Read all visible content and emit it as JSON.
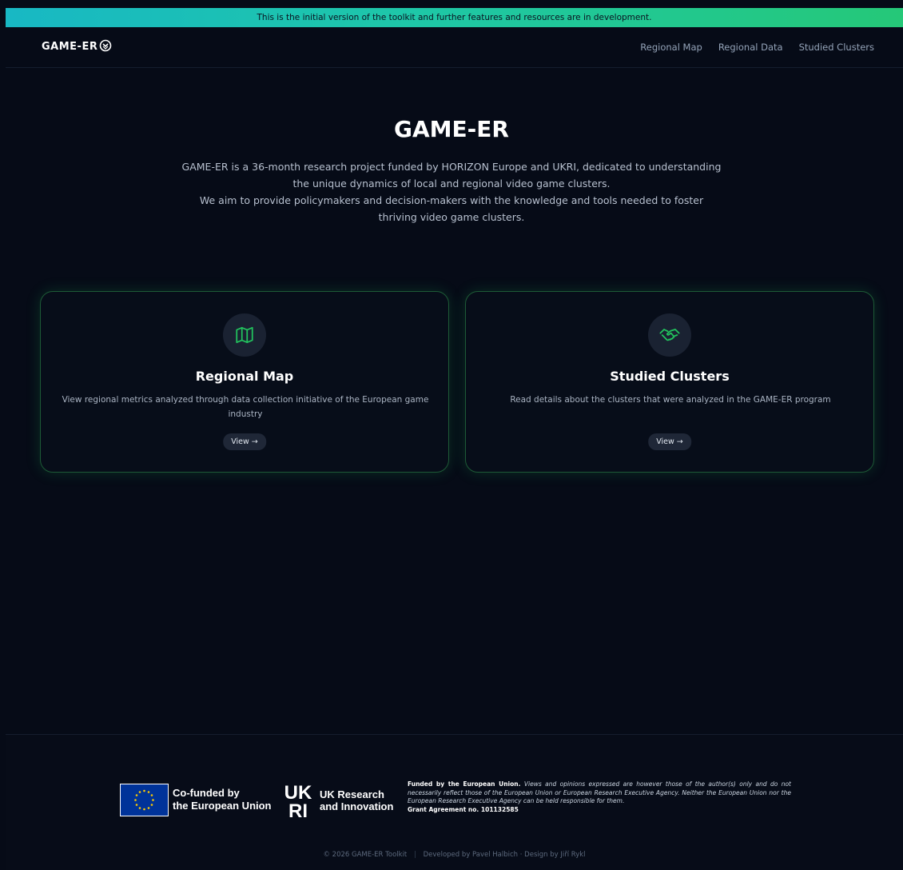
{
  "banner": {
    "text": "This is the initial version of the toolkit and further features and resources are in development."
  },
  "header": {
    "logo_text": "GAME-ER",
    "nav": [
      {
        "label": "Regional Map"
      },
      {
        "label": "Regional Data"
      },
      {
        "label": "Studied Clusters"
      }
    ]
  },
  "hero": {
    "title": "GAME-ER",
    "paragraph1": "GAME-ER is a 36-month research project funded by HORIZON Europe and UKRI, dedicated to understanding the unique dynamics of local and regional video game clusters.",
    "paragraph2": "We aim to provide policymakers and decision-makers with the knowledge and tools needed to foster thriving video game clusters."
  },
  "cards": [
    {
      "icon": "map-icon",
      "title": "Regional Map",
      "description": "View regional metrics analyzed through data collection initiative of the European game industry",
      "button": "View →"
    },
    {
      "icon": "handshake-icon",
      "title": "Studied Clusters",
      "description": "Read details about the clusters that were analyzed in the GAME-ER program",
      "button": "View →"
    }
  ],
  "footer": {
    "eu_line1": "Co-funded by",
    "eu_line2": "the European Union",
    "ukri_mark": "UKRI",
    "ukri_line1": "UK Research",
    "ukri_line2": "and Innovation",
    "disclaimer_bold": "Funded by the European Union.",
    "disclaimer_italic": "Views and opinions expressed are however those of the author(s) only and do not necessarily reflect those of the European Union or European Research Executive Agency. Neither the European Union nor the European Research Executive Agency can be held responsible for them.",
    "grant": "Grant Agreement no. 101132585",
    "copyright": "© 2026 GAME-ER Toolkit",
    "credits": "Developed by Pavel Halbich · Design by Jiří Rykl"
  },
  "colors": {
    "background": "#060b17",
    "accent_green": "#22c55e",
    "banner_start": "#18b8c4",
    "banner_end": "#25c878"
  }
}
